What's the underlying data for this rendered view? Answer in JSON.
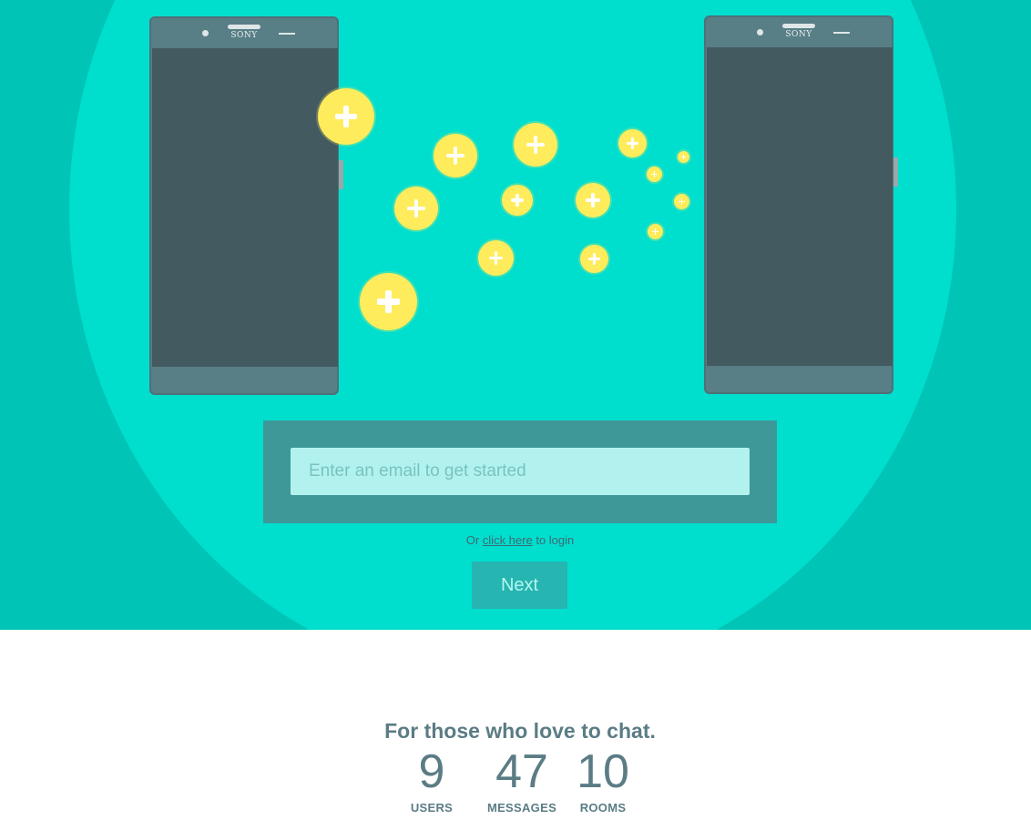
{
  "hero": {
    "left_phone_brand": "SONY",
    "right_phone_brand": "SONY",
    "colors": {
      "background": "#00c4b5",
      "circle": "#00dece",
      "phone_body": "#587e86",
      "phone_screen": "#425a60",
      "coin": "#ffec5c"
    }
  },
  "signup": {
    "email_placeholder": "Enter an email to get started",
    "login_prefix": "Or",
    "login_link": "click here",
    "login_suffix": "to login",
    "next_label": "Next"
  },
  "stats": {
    "tagline": "For those who love to chat.",
    "items": [
      {
        "value": "9",
        "label": "USERS"
      },
      {
        "value": "47",
        "label": "MESSAGES"
      },
      {
        "value": "10",
        "label": "ROOMS"
      }
    ]
  }
}
